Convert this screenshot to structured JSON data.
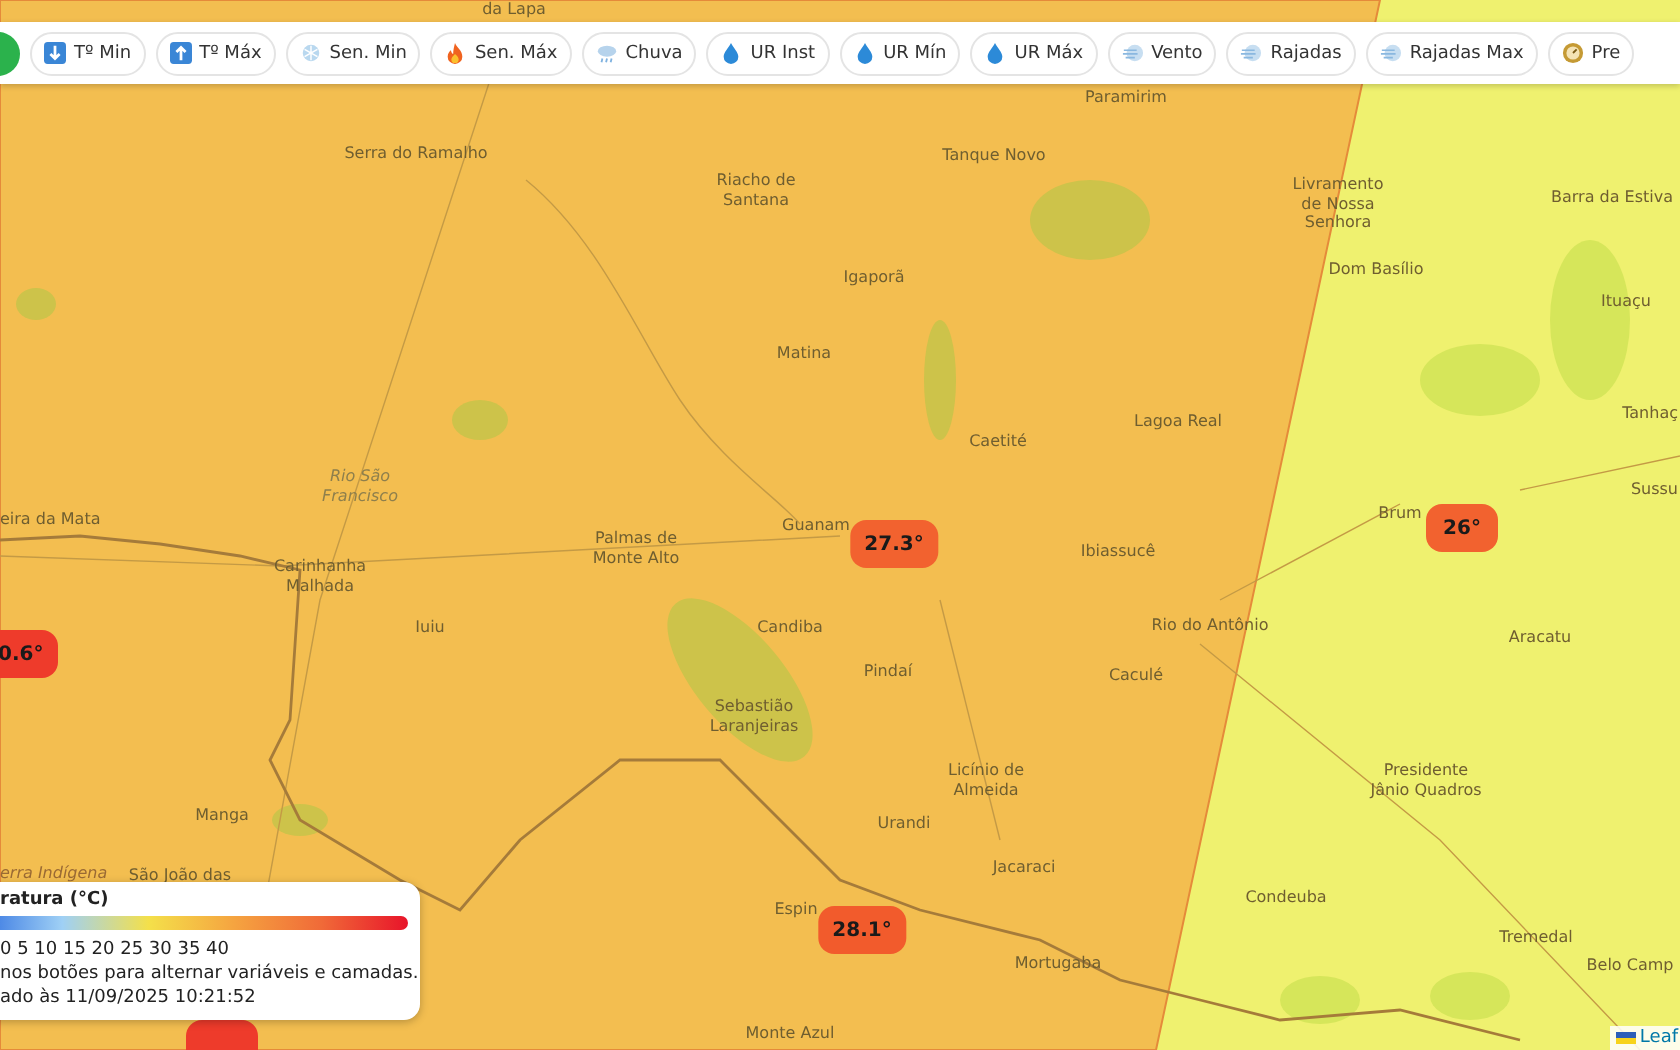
{
  "toolbar": {
    "buttons": [
      {
        "kind": "temp-min",
        "label": "Tº Min"
      },
      {
        "kind": "temp-max",
        "label": "Tº Máx"
      },
      {
        "kind": "cold",
        "label": "Sen. Min"
      },
      {
        "kind": "fire",
        "label": "Sen. Máx"
      },
      {
        "kind": "rain",
        "label": "Chuva"
      },
      {
        "kind": "drop",
        "label": "UR Inst"
      },
      {
        "kind": "drop",
        "label": "UR Mín"
      },
      {
        "kind": "drop",
        "label": "UR Máx"
      },
      {
        "kind": "wind",
        "label": "Vento"
      },
      {
        "kind": "wind",
        "label": "Rajadas"
      },
      {
        "kind": "wind",
        "label": "Rajadas Max"
      },
      {
        "kind": "gauge",
        "label": "Pre"
      }
    ]
  },
  "map": {
    "places": [
      {
        "name": "da Lapa"
      },
      {
        "name": "Paramirim"
      },
      {
        "name": "Serra do Ramalho"
      },
      {
        "name": "Tanque Novo"
      },
      {
        "name": "Riacho de\nSantana"
      },
      {
        "name": "Livramento\nde Nossa\nSenhora"
      },
      {
        "name": "Barra da Estiva"
      },
      {
        "name": "Dom Basílio"
      },
      {
        "name": "Igaporã"
      },
      {
        "name": "Ituaçu"
      },
      {
        "name": "Matina"
      },
      {
        "name": "Caetité"
      },
      {
        "name": "Lagoa Real"
      },
      {
        "name": "Tanhaç"
      },
      {
        "name": "Rio São\nFrancisco",
        "kind": "river"
      },
      {
        "name": "Sussu"
      },
      {
        "name": "eira da Mata"
      },
      {
        "name": "Guanam"
      },
      {
        "name": "Brum"
      },
      {
        "name": "Carinhanha\nMalhada"
      },
      {
        "name": "Palmas de\nMonte Alto"
      },
      {
        "name": "Ibiassucê"
      },
      {
        "name": "Iuiu"
      },
      {
        "name": "Candiba"
      },
      {
        "name": "Rio do Antônio"
      },
      {
        "name": "Aracatu"
      },
      {
        "name": "Pindaí"
      },
      {
        "name": "Caculé"
      },
      {
        "name": "Sebastião\nLaranjeiras"
      },
      {
        "name": "Licínio de\nAlmeida"
      },
      {
        "name": "Presidente\nJânio Quadros"
      },
      {
        "name": "Manga"
      },
      {
        "name": "Urandi"
      },
      {
        "name": "erra Indígena",
        "kind": "area"
      },
      {
        "name": "São João das"
      },
      {
        "name": "Jacaraci"
      },
      {
        "name": "Espin"
      },
      {
        "name": "Condeuba"
      },
      {
        "name": "Tremedal"
      },
      {
        "name": "Mortugaba"
      },
      {
        "name": "Belo Camp"
      },
      {
        "name": "Monte Azul"
      }
    ],
    "markers": [
      {
        "value": "26°",
        "color": "#f2622f"
      },
      {
        "value": "27.3°",
        "color": "#f2622f"
      },
      {
        "value": "0.6°",
        "color": "#ee3b2b"
      },
      {
        "value": "28.1°",
        "color": "#f25b2c"
      },
      {
        "color": "#ee3b2b"
      }
    ]
  },
  "legend": {
    "title": "ratura (°C)",
    "scale": "0 5 10 15 20 25 30 35 40",
    "hint": "nos botões para alternar variáveis e camadas.",
    "updated": "ado às 11/09/2025 10:21:52"
  },
  "attribution": "Leaf"
}
